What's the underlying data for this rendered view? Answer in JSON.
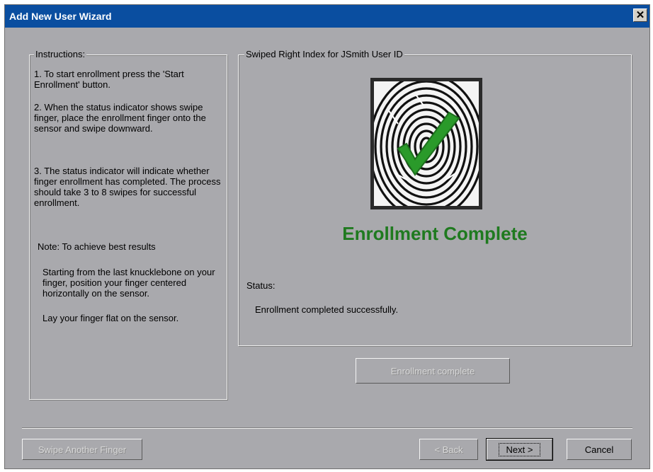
{
  "window": {
    "title": "Add New User Wizard",
    "close_glyph": "✕"
  },
  "instructions": {
    "legend": "Instructions:",
    "step1": "1. To start enrollment press the 'Start Enrollment' button.",
    "step2": "2. When the status indicator shows swipe finger, place the enrollment finger onto the sensor and swipe downward.",
    "step3": "3. The status indicator will indicate whether finger enrollment has completed.  The process should take 3 to 8 swipes for successful enrollment.",
    "note": "Note: To achieve best results",
    "tip1": "Starting from the last knucklebone on your finger, position your finger centered horizontally on the sensor.",
    "tip2": "Lay your finger flat on the sensor."
  },
  "enrollment": {
    "legend": "Swiped Right Index for JSmith User ID",
    "heading": "Enrollment Complete",
    "status_label": "Status:",
    "status_text": "Enrollment completed successfully.",
    "fingerprint_icon": "fingerprint-checkmark-icon",
    "heading_color": "#1f7a1f",
    "check_color": "#2a9a2a"
  },
  "buttons": {
    "enrollment_complete": "Enrollment complete",
    "swipe_another": "Swipe Another Finger",
    "back": "< Back",
    "next": "Next >",
    "cancel": "Cancel"
  },
  "colors": {
    "titlebar": "#0a4ea0",
    "dialog_bg": "#a9a9ad"
  }
}
